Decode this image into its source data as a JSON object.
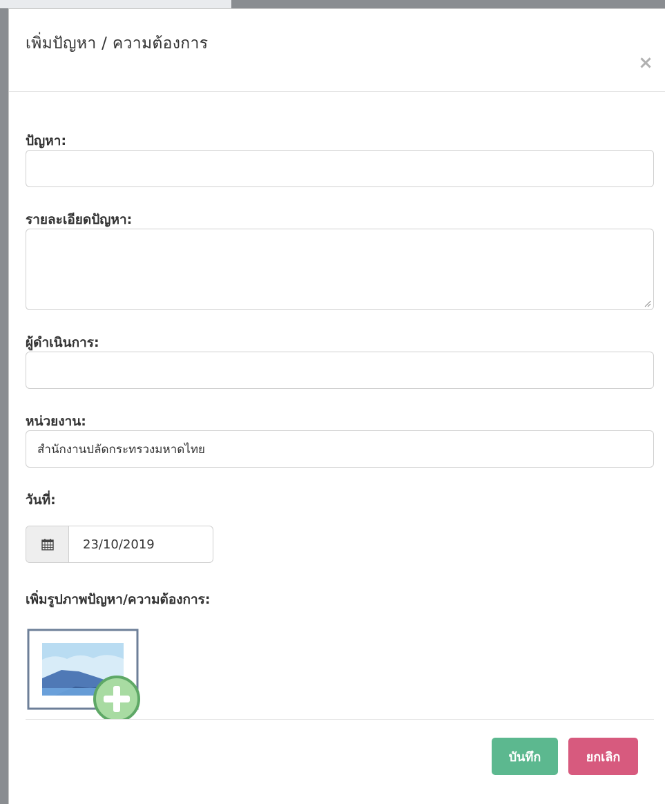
{
  "modal": {
    "title": "เพิ่มปัญหา / ความต้องการ",
    "close_symbol": "×"
  },
  "form": {
    "problem": {
      "label": "ปัญหา:",
      "value": ""
    },
    "details": {
      "label": "รายละเอียดปัญหา:",
      "value": ""
    },
    "operator": {
      "label": "ผู้ดำเนินการ:",
      "value": ""
    },
    "department": {
      "label": "หน่วยงาน:",
      "value": "สำนักงานปลัดกระทรวงมหาดไทย"
    },
    "date": {
      "label": "วันที่:",
      "value": "23/10/2019",
      "icon": "calendar-icon"
    },
    "image": {
      "label": "เพิ่มรูปภาพปัญหา/ความต้องการ:",
      "icon": "add-image-icon"
    }
  },
  "footer": {
    "save_label": "บันทึก",
    "cancel_label": "ยกเลิก"
  },
  "colors": {
    "save": "#5cb88f",
    "cancel": "#d75a7e",
    "backdrop": "#8a8d91"
  }
}
